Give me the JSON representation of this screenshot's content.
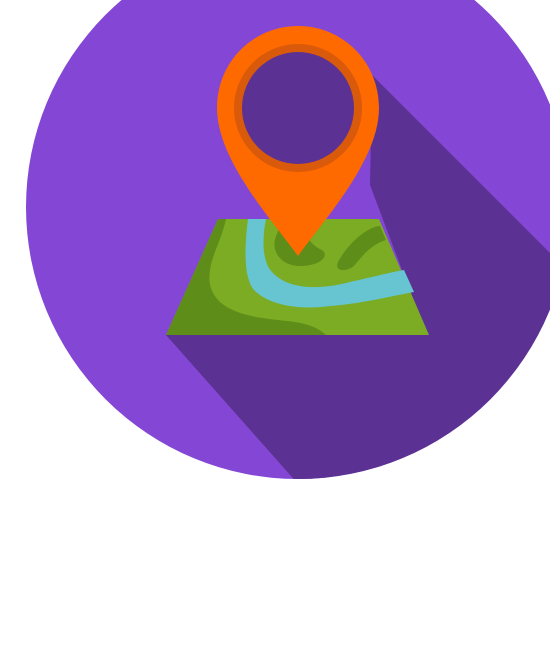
{
  "icon": {
    "name": "map-location-pin-icon",
    "colors": {
      "background": "#ffffff",
      "circle": "#8446d4",
      "long_shadow": "#5b3293",
      "map_land": "#7bac23",
      "map_land_dark": "#5f8d1a",
      "river": "#67c5d2",
      "pin": "#ff6a00",
      "pin_ring": "#d95a0b",
      "pin_hole": "#5b3293"
    }
  }
}
